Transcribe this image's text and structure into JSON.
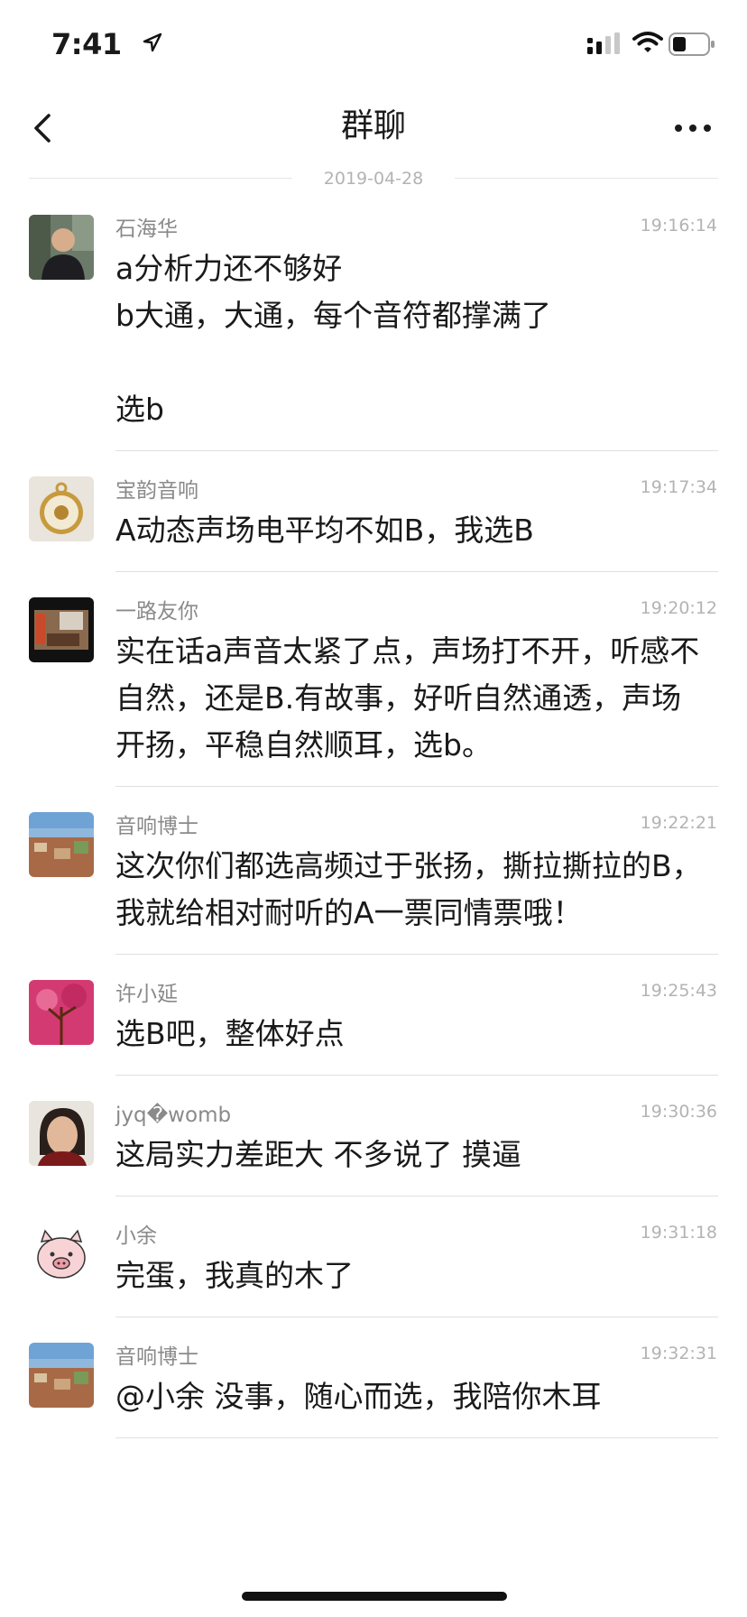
{
  "status_bar": {
    "time": "7:41"
  },
  "nav": {
    "title": "群聊"
  },
  "date_divider": "2019-04-28",
  "messages": [
    {
      "sender": "石海华",
      "time": "19:16:14",
      "text": "a分析力还不够好\nb大通，大通，每个音符都撑满了\n\n选b",
      "avatar": "avatar-photo-man"
    },
    {
      "sender": "宝韵音响",
      "time": "19:17:34",
      "text": "A动态声场电平均不如B，我选B",
      "avatar": "avatar-pocket-watch"
    },
    {
      "sender": "一路友你",
      "time": "19:20:12",
      "text": "实在话a声音太紧了点，声场打不开，听感不自然，还是B.有故事，好听自然通透，声场开扬，平稳自然顺耳，选b。",
      "avatar": "avatar-room"
    },
    {
      "sender": "音响博士",
      "time": "19:22:21",
      "text": "这次你们都选高频过于张扬，撕拉撕拉的B，我就给相对耐听的A一票同情票哦！",
      "avatar": "avatar-landscape"
    },
    {
      "sender": "许小延",
      "time": "19:25:43",
      "text": "选B吧，整体好点",
      "avatar": "avatar-pink-tree"
    },
    {
      "sender": "jyq�womb",
      "time": "19:30:36",
      "text": "这局实力差距大 不多说了 摸逼",
      "avatar": "avatar-woman"
    },
    {
      "sender": "小余",
      "time": "19:31:18",
      "text": "完蛋，我真的木了",
      "avatar": "avatar-pig"
    },
    {
      "sender": "音响博士",
      "time": "19:32:31",
      "text": "@小余 没事，随心而选，我陪你木耳",
      "avatar": "avatar-landscape"
    }
  ]
}
